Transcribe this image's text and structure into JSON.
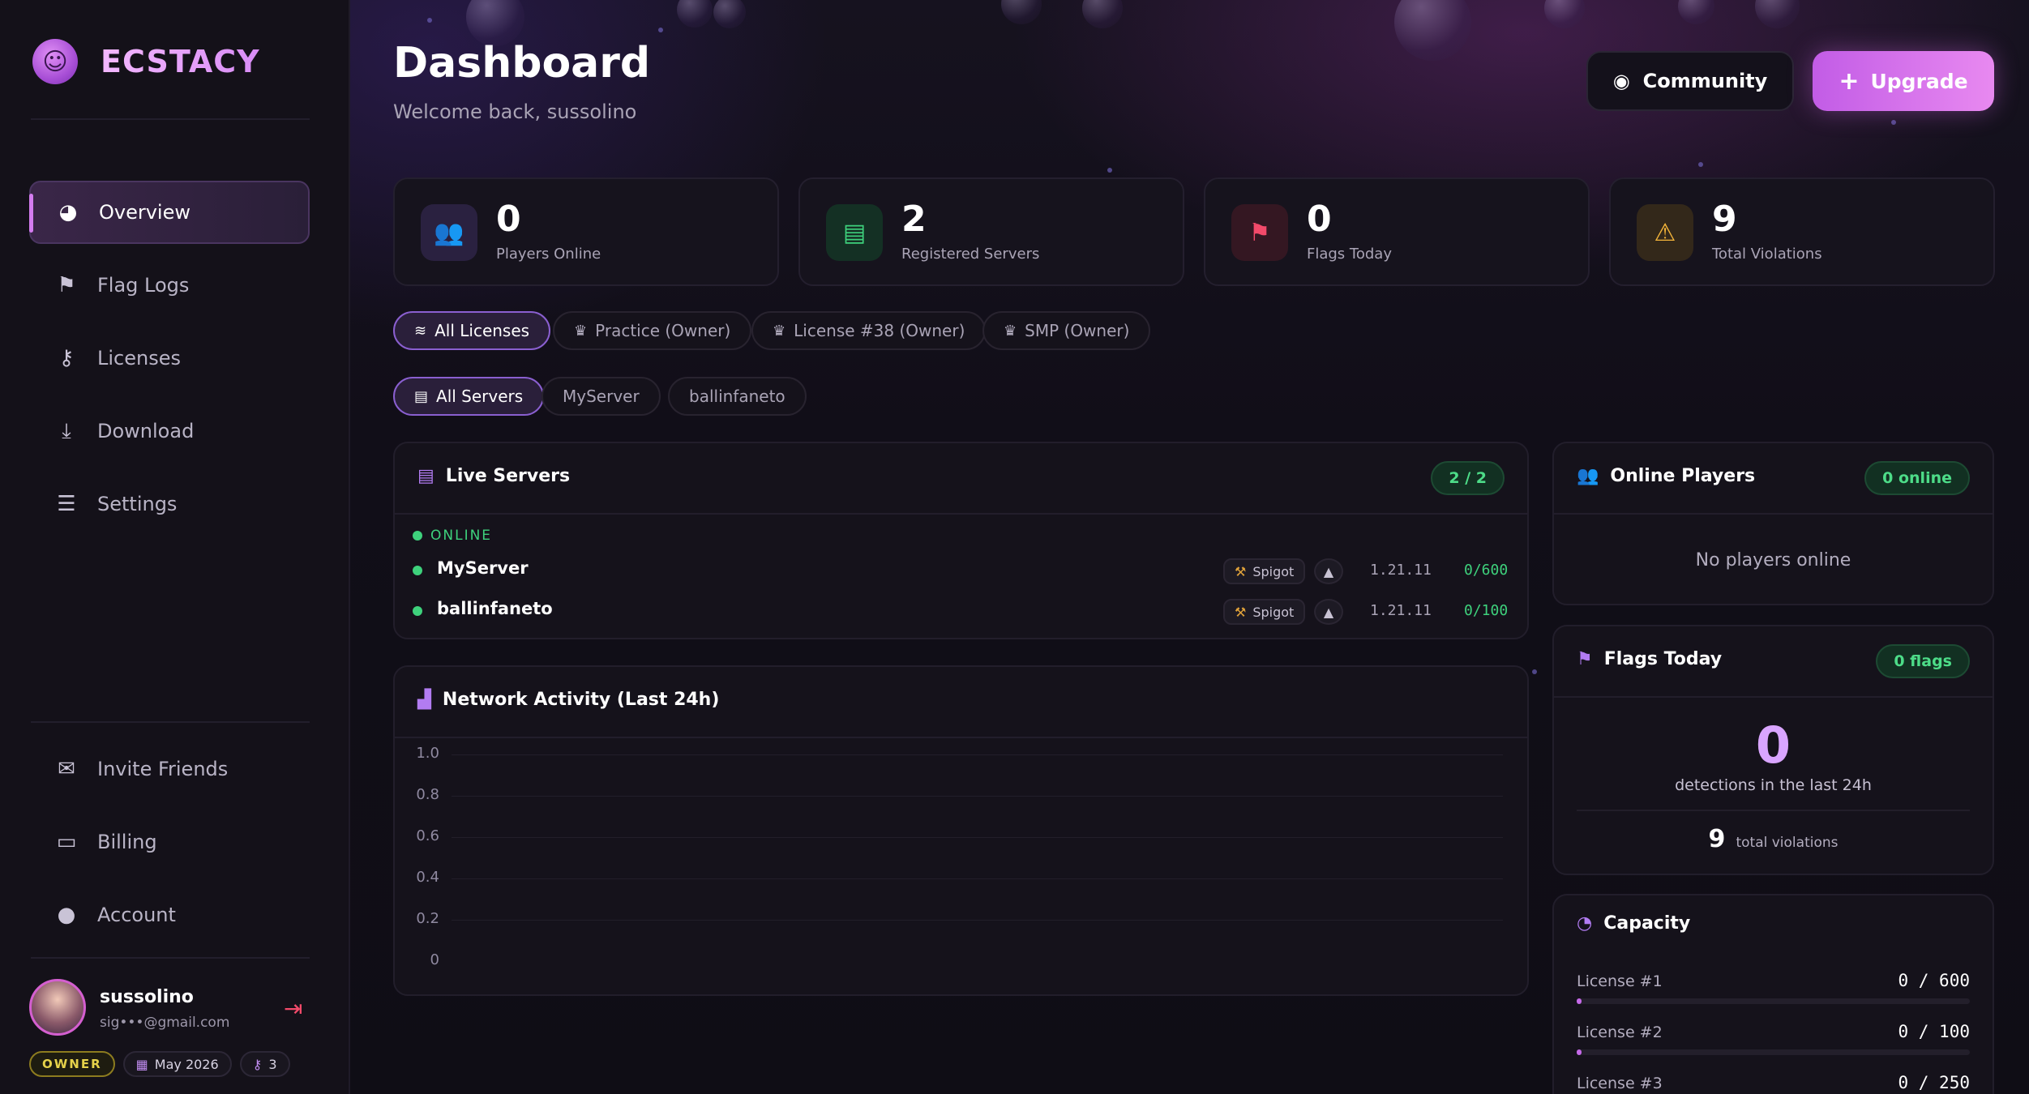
{
  "brand": {
    "name": "ECSTACY"
  },
  "nav": {
    "items": [
      {
        "label": "Overview",
        "icon": "pie-chart-icon",
        "glyph": "◕",
        "active": true
      },
      {
        "label": "Flag Logs",
        "icon": "flag-icon",
        "glyph": "⚑"
      },
      {
        "label": "Licenses",
        "icon": "key-icon",
        "glyph": "⚷"
      },
      {
        "label": "Download",
        "icon": "download-icon",
        "glyph": "⤓"
      },
      {
        "label": "Settings",
        "icon": "sliders-icon",
        "glyph": "☰"
      }
    ],
    "secondary": [
      {
        "label": "Invite Friends",
        "icon": "gift-icon",
        "glyph": "✉"
      },
      {
        "label": "Billing",
        "icon": "credit-card-icon",
        "glyph": "▭"
      },
      {
        "label": "Account",
        "icon": "user-icon",
        "glyph": "●"
      }
    ]
  },
  "user": {
    "name": "sussolino",
    "email": "sig•••@gmail.com",
    "role_badge": "OWNER",
    "joined": "May 2026",
    "keys": "3"
  },
  "header": {
    "title": "Dashboard",
    "subtitle": "Welcome back, sussolino",
    "community_label": "Community",
    "upgrade_label": "Upgrade"
  },
  "stats": [
    {
      "value": "0",
      "label": "Players Online",
      "icon": "users-icon",
      "glyph": "👥",
      "color": "#8b5cf6",
      "bg": "#2a2140"
    },
    {
      "value": "2",
      "label": "Registered Servers",
      "icon": "server-icon",
      "glyph": "▤",
      "color": "#3ed17c",
      "bg": "#143024"
    },
    {
      "value": "0",
      "label": "Flags Today",
      "icon": "flag-icon",
      "glyph": "⚑",
      "color": "#f24a6a",
      "bg": "#341722"
    },
    {
      "value": "9",
      "label": "Total Violations",
      "icon": "warning-icon",
      "glyph": "⚠",
      "color": "#f5b53a",
      "bg": "#33281a"
    }
  ],
  "license_filters": [
    {
      "label": "All Licenses",
      "active": true
    },
    {
      "label": "Practice (Owner)"
    },
    {
      "label": "License #38 (Owner)"
    },
    {
      "label": "SMP (Owner)"
    }
  ],
  "server_filters": [
    {
      "label": "All Servers",
      "active": true
    },
    {
      "label": "MyServer"
    },
    {
      "label": "ballinfaneto"
    }
  ],
  "live_servers": {
    "title": "Live Servers",
    "count": "2 / 2",
    "status_label": "ONLINE",
    "rows": [
      {
        "name": "MyServer",
        "software": "Spigot",
        "version": "1.21.11",
        "players": "0/600"
      },
      {
        "name": "ballinfaneto",
        "software": "Spigot",
        "version": "1.21.11",
        "players": "0/100"
      }
    ]
  },
  "network": {
    "title": "Network Activity (Last 24h)",
    "y_ticks": [
      "1.0",
      "0.8",
      "0.6",
      "0.4",
      "0.2",
      "0"
    ]
  },
  "online_players": {
    "title": "Online Players",
    "badge": "0 online",
    "empty_text": "No players online"
  },
  "flags_today": {
    "title": "Flags Today",
    "badge": "0 flags",
    "count": "0",
    "count_label": "detections in the last 24h",
    "total": "9",
    "total_label": "total violations"
  },
  "capacity": {
    "title": "Capacity",
    "rows": [
      {
        "label": "License #1",
        "value": "0 / 600",
        "fraction": 0
      },
      {
        "label": "License #2",
        "value": "0 / 100",
        "fraction": 0
      },
      {
        "label": "License #3",
        "value": "0 / 250",
        "fraction": 0
      }
    ]
  }
}
